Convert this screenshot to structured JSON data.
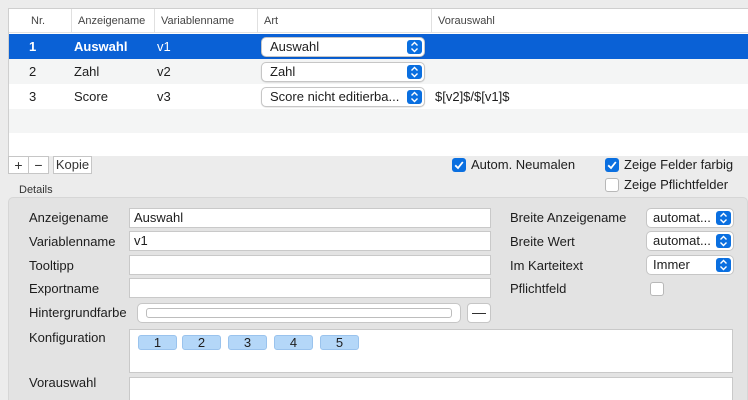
{
  "table": {
    "headers": [
      "Nr.",
      "Anzeigename",
      "Variablenname",
      "Art",
      "Vorauswahl"
    ],
    "rows": [
      {
        "nr": "1",
        "anzeigename": "Auswahl",
        "variablenname": "v1",
        "art": "Auswahl",
        "vorauswahl": "",
        "selected": true
      },
      {
        "nr": "2",
        "anzeigename": "Zahl",
        "variablenname": "v2",
        "art": "Zahl",
        "vorauswahl": "",
        "selected": false
      },
      {
        "nr": "3",
        "anzeigename": "Score",
        "variablenname": "v3",
        "art": "Score nicht editierba...",
        "vorauswahl": "$[v2]$/$[v1]$",
        "selected": false
      }
    ]
  },
  "toolbar": {
    "add_label": "+",
    "remove_label": "−",
    "copy_label": "Kopie"
  },
  "options": {
    "autom_neumalen": {
      "label": "Autom. Neumalen",
      "checked": true
    },
    "zeige_felder_farbig": {
      "label": "Zeige Felder farbig",
      "checked": true
    },
    "zeige_pflichtfelder": {
      "label": "Zeige Pflichtfelder",
      "checked": false
    }
  },
  "details": {
    "section_title": "Details",
    "anzeigename_label": "Anzeigename",
    "anzeigename_value": "Auswahl",
    "variablenname_label": "Variablenname",
    "variablenname_value": "v1",
    "tooltipp_label": "Tooltipp",
    "tooltipp_value": "",
    "exportname_label": "Exportname",
    "exportname_value": "",
    "hintergrundfarbe_label": "Hintergrundfarbe",
    "hintergrundfarbe_remove_label": "—",
    "konfiguration_label": "Konfiguration",
    "konfiguration_tokens": [
      "1",
      "2",
      "3",
      "4",
      "5"
    ],
    "vorauswahl_label": "Vorauswahl",
    "vorauswahl_value": "",
    "breite_anzeigename_label": "Breite Anzeigename",
    "breite_anzeigename_value": "automat...",
    "breite_wert_label": "Breite Wert",
    "breite_wert_value": "automat...",
    "im_karteitext_label": "Im Karteitext",
    "im_karteitext_value": "Immer",
    "pflichtfeld_label": "Pflichtfeld",
    "pflichtfeld_checked": false
  },
  "colors": {
    "selection": "#0a61d6",
    "accent": "#0a6fe0",
    "token_fill": "#b4d7f8"
  }
}
